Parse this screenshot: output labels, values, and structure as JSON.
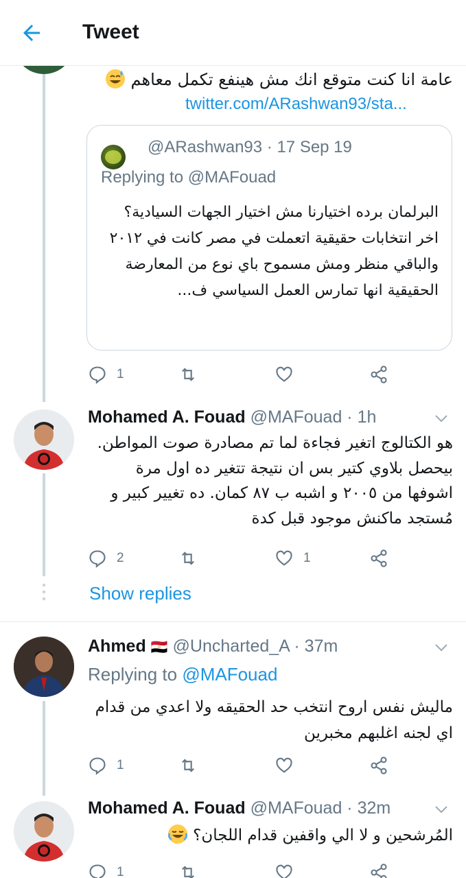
{
  "header": {
    "title": "Tweet"
  },
  "tweet0": {
    "text": "عامة انا كنت متوقع انك مش هينفع تكمل معاهم",
    "link": "twitter.com/ARashwan93/sta...",
    "actions": {
      "reply_count": "1"
    },
    "quote": {
      "handle_date": "@ARashwan93 · 17 Sep 19",
      "replying": "Replying to @MAFouad",
      "text": "البرلمان برده اختيارنا مش اختيار الجهات السيادية؟\nاخر انتخابات حقيقية اتعملت في مصر كانت في ٢٠١٢ والباقي منظر ومش مسموح باي نوع من المعارضة الحقيقية انها تمارس العمل السياسي ف..."
    }
  },
  "tweet1": {
    "name": "Mohamed A. Fouad",
    "handle_time": "@MAFouad · 1h",
    "text": "هو الكتالوج اتغير فجاءة لما تم مصادرة صوت المواطن. بيحصل بلاوي كتير بس ان نتيجة تتغير ده اول مرة اشوفها من ٢٠٠٥ و اشبه ب ٨٧ كمان. ده تغيير كبير و مُستجد ماكنش موجود قبل كدة",
    "reply_count": "2",
    "like_count": "1",
    "show_replies": "Show replies"
  },
  "tweet2": {
    "name": "Ahmed",
    "flag": "🇪🇬",
    "handle_time": "@Uncharted_A · 37m",
    "replying_prefix": "Replying to ",
    "replying_mention": "@MAFouad",
    "text": "ماليش نفس اروح انتخب حد الحقيقه ولا اعدي من قدام اي لجنه اغلبهم مخبرين",
    "reply_count": "1"
  },
  "tweet3": {
    "name": "Mohamed A. Fouad",
    "handle_time": "@MAFouad · 32m",
    "text": "المُرشحين و لا الي واقفين قدام اللجان؟",
    "reply_count": "1"
  },
  "colors": {
    "accent": "#1b95e0",
    "muted": "#657786",
    "border": "#ccd6dd"
  },
  "icons": [
    "back-arrow-icon",
    "reply-icon",
    "retweet-icon",
    "like-icon",
    "share-icon",
    "chevron-down-icon",
    "sweat-smile-emoji",
    "joy-emoji"
  ]
}
